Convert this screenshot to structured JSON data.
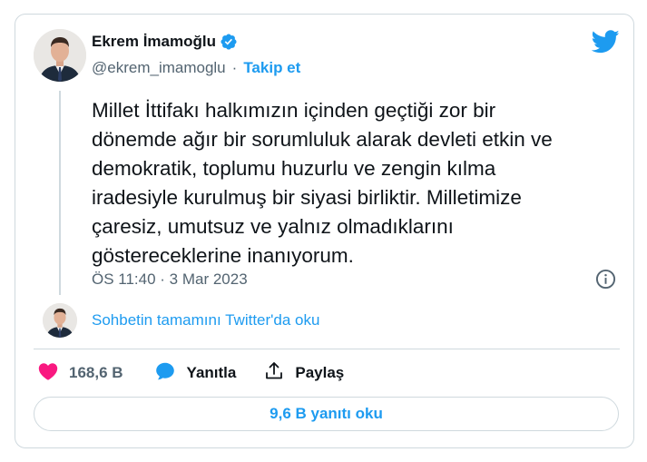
{
  "author": {
    "name": "Ekrem İmamoğlu",
    "handle": "@ekrem_imamoglu",
    "separator": "·",
    "follow_label": "Takip et",
    "verified": true,
    "avatar": "portrait-photo"
  },
  "tweet": {
    "text": "Millet İttifakı halkımızın içinden geçtiği zor bir\ndönemde ağır bir sorumluluk alarak devleti etkin ve\ndemokratik, toplumu huzurlu ve zengin kılma\niradesiyle kurulmuş bir siyasi birliktir. Milletimize\nçaresiz, umutsuz ve yalnız olmadıklarını\ngöstereceklerine inanıyorum.",
    "timestamp": "ÖS 11:40 · 3 Mar 2023"
  },
  "conversation": {
    "link_label": "Sohbetin tamamını Twitter'da oku"
  },
  "actions": {
    "like_count": "168,6 B",
    "reply_label": "Yanıtla",
    "share_label": "Paylaş"
  },
  "footer": {
    "read_replies_label": "9,6 B yanıtı oku"
  },
  "icons": {
    "brand": "twitter-bird-icon",
    "verified": "verified-badge-icon",
    "info": "info-icon",
    "like": "heart-icon",
    "reply": "speech-bubble-icon",
    "share": "share-upload-icon"
  },
  "colors": {
    "accent": "#1d9bf0",
    "like": "#f91880",
    "text": "#0f1419",
    "secondary": "#536471",
    "border": "#cfd9de"
  }
}
